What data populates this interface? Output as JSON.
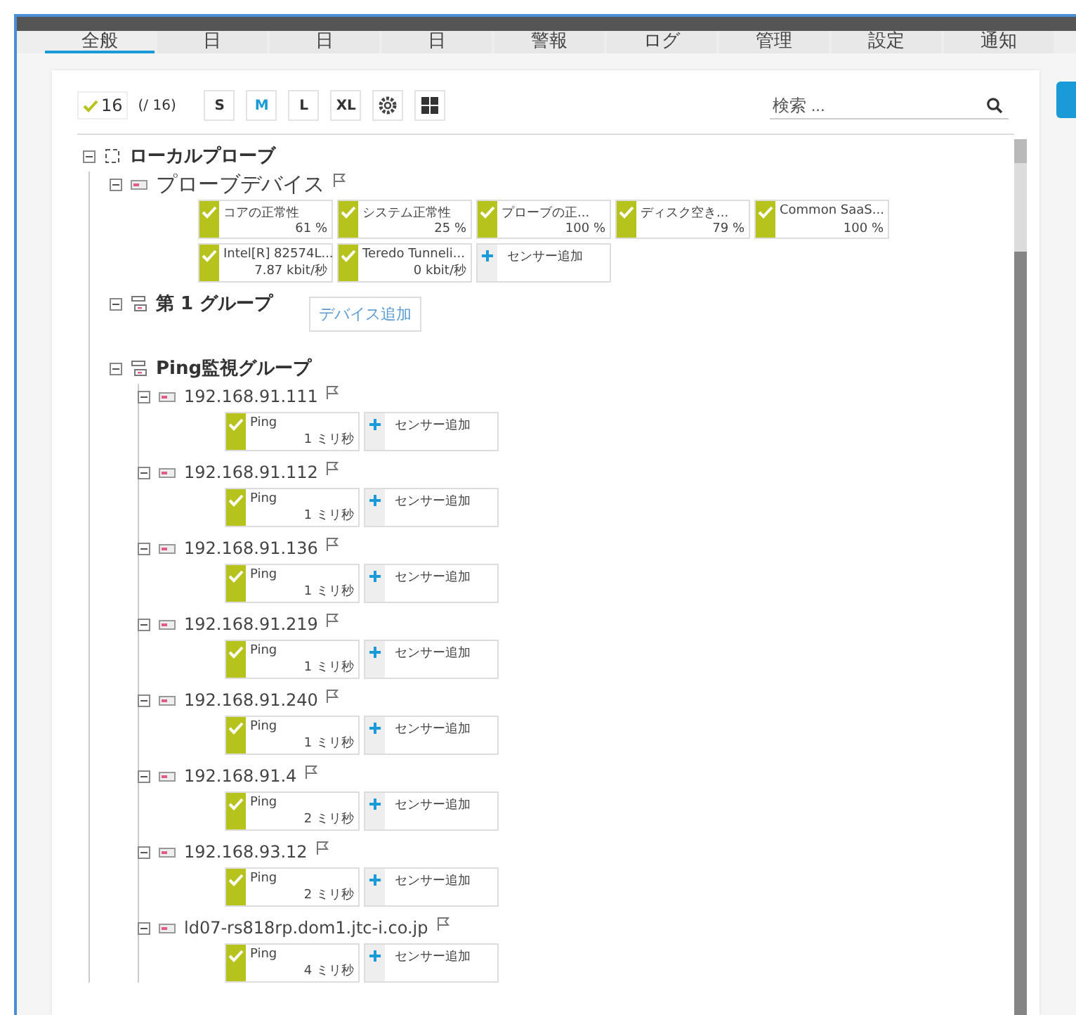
{
  "tabs": [
    {
      "label": "全般",
      "selected": true
    },
    {
      "label": "日",
      "selected": false
    },
    {
      "label": "日",
      "selected": false
    },
    {
      "label": "日",
      "selected": false
    },
    {
      "label": "警報",
      "selected": false
    },
    {
      "label": "ログ",
      "selected": false
    },
    {
      "label": "管理",
      "selected": false
    },
    {
      "label": "設定",
      "selected": false
    },
    {
      "label": "通知",
      "selected": false
    }
  ],
  "toolbar": {
    "ok_count": "16",
    "total": "(/ 16)",
    "sizes": [
      {
        "label": "S",
        "selected": false
      },
      {
        "label": "M",
        "selected": true
      },
      {
        "label": "L",
        "selected": false
      },
      {
        "label": "XL",
        "selected": false
      }
    ],
    "search": {
      "placeholder": "検索 ..."
    }
  },
  "tree": [
    {
      "kind": "probe",
      "name": "ローカルプローブ",
      "expanded": true,
      "children": [
        {
          "kind": "device",
          "name": "プローブデバイス",
          "expanded": true,
          "sensors": [
            {
              "kind": "sensor",
              "color": "#b6c31d",
              "name": "コアの正常性",
              "value": "61 %"
            },
            {
              "kind": "sensor",
              "color": "#b6c31d",
              "name": "システム正常性",
              "value": "25 %"
            },
            {
              "kind": "sensor",
              "color": "#b6c31d",
              "name": "プローブの正...",
              "value": "100 %"
            },
            {
              "kind": "sensor",
              "color": "#b6c31d",
              "name": "ディスク空き...",
              "value": "79 %"
            },
            {
              "kind": "sensor",
              "color": "#b6c31d",
              "name": "Common SaaS...",
              "value": "100 %"
            },
            {
              "kind": "sensor",
              "color": "#b6c31d",
              "name": "Intel[R] 82574L...",
              "value": "7.87 kbit/秒"
            },
            {
              "kind": "sensor",
              "color": "#b6c31d",
              "name": "Teredo Tunneli...",
              "value": "0 kbit/秒"
            },
            {
              "kind": "add",
              "name": "センサー追加"
            }
          ]
        },
        {
          "kind": "group",
          "name": "第 1 グループ",
          "expanded": true,
          "add_device": "デバイス追加"
        },
        {
          "kind": "group",
          "name": "Ping監視グループ",
          "expanded": true,
          "children": [
            {
              "kind": "device",
              "name": "192.168.91.111",
              "expanded": true,
              "sensors": [
                {
                  "kind": "sensor",
                  "color": "#b6c31d",
                  "name": "Ping",
                  "value": "1 ミリ秒"
                },
                {
                  "kind": "add",
                  "name": "センサー追加"
                }
              ]
            },
            {
              "kind": "device",
              "name": "192.168.91.112",
              "expanded": true,
              "sensors": [
                {
                  "kind": "sensor",
                  "color": "#b6c31d",
                  "name": "Ping",
                  "value": "1 ミリ秒"
                },
                {
                  "kind": "add",
                  "name": "センサー追加"
                }
              ]
            },
            {
              "kind": "device",
              "name": "192.168.91.136",
              "expanded": true,
              "sensors": [
                {
                  "kind": "sensor",
                  "color": "#b6c31d",
                  "name": "Ping",
                  "value": "1 ミリ秒"
                },
                {
                  "kind": "add",
                  "name": "センサー追加"
                }
              ]
            },
            {
              "kind": "device",
              "name": "192.168.91.219",
              "expanded": true,
              "sensors": [
                {
                  "kind": "sensor",
                  "color": "#b6c31d",
                  "name": "Ping",
                  "value": "1 ミリ秒"
                },
                {
                  "kind": "add",
                  "name": "センサー追加"
                }
              ]
            },
            {
              "kind": "device",
              "name": "192.168.91.240",
              "expanded": true,
              "sensors": [
                {
                  "kind": "sensor",
                  "color": "#b6c31d",
                  "name": "Ping",
                  "value": "1 ミリ秒"
                },
                {
                  "kind": "add",
                  "name": "センサー追加"
                }
              ]
            },
            {
              "kind": "device",
              "name": "192.168.91.4",
              "expanded": true,
              "sensors": [
                {
                  "kind": "sensor",
                  "color": "#b6c31d",
                  "name": "Ping",
                  "value": "2 ミリ秒"
                },
                {
                  "kind": "add",
                  "name": "センサー追加"
                }
              ]
            },
            {
              "kind": "device",
              "name": "192.168.93.12",
              "expanded": true,
              "sensors": [
                {
                  "kind": "sensor",
                  "color": "#b6c31d",
                  "name": "Ping",
                  "value": "2 ミリ秒"
                },
                {
                  "kind": "add",
                  "name": "センサー追加"
                }
              ]
            },
            {
              "kind": "device",
              "name": "ld07-rs818rp.dom1.jtc-i.co.jp",
              "expanded": true,
              "sensors": [
                {
                  "kind": "sensor",
                  "color": "#b6c31d",
                  "name": "Ping",
                  "value": "4 ミリ秒"
                },
                {
                  "kind": "add",
                  "name": "センサー追加"
                }
              ]
            }
          ]
        }
      ]
    }
  ]
}
